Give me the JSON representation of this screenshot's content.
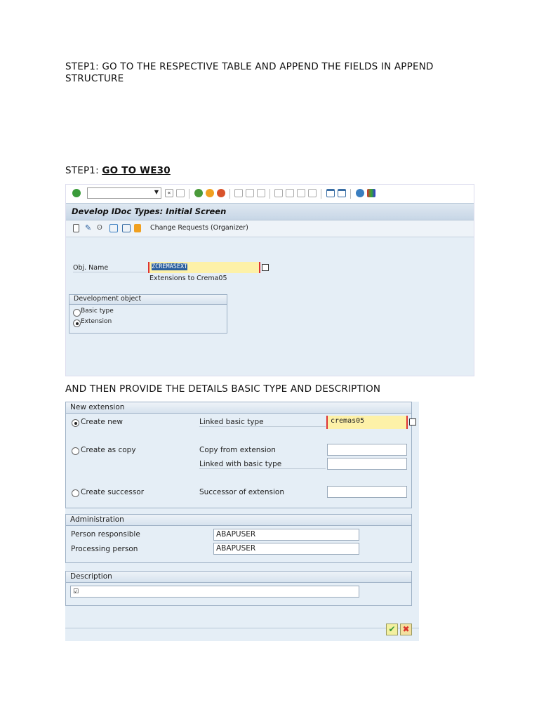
{
  "doc": {
    "step1_text": "STEP1: GO TO THE  RESPECTIVE TABLE AND APPEND THE FIELDS  IN APPEND STRUCTURE",
    "step2_prefix": "STEP1: ",
    "step2_link": "GO TO WE30",
    "then_text": "AND THEN PROVIDE THE DETAILS BASIC TYPE AND DESCRIPTION"
  },
  "screen1": {
    "title": "Develop IDoc Types: Initial Screen",
    "change_requests": "Change Requests (Organizer)",
    "obj_name_label": "Obj. Name",
    "obj_name_value": "ZCREMASEXT",
    "obj_desc": "Extensions to Crema05",
    "dev_object_title": "Development object",
    "radio_basic": "Basic type",
    "radio_extension": "Extension",
    "selected": "Extension"
  },
  "screen2": {
    "new_ext_title": "New extension",
    "create_new": "Create new",
    "create_copy": "Create as copy",
    "create_successor": "Create successor",
    "linked_basic_type_label": "Linked basic type",
    "linked_basic_type_value": "cremas05",
    "copy_from_label": "Copy from extension",
    "linked_with_label": "Linked with basic type",
    "successor_label": "Successor of extension",
    "admin_title": "Administration",
    "person_resp_label": "Person responsible",
    "person_resp_value": "ABAPUSER",
    "processing_label": "Processing person",
    "processing_value": "ABAPUSER",
    "description_title": "Description",
    "description_value": ""
  },
  "colors": {
    "sap_bg": "#e5eef6",
    "required_field": "#fdf1a8",
    "accent": "#2a5f9e"
  }
}
